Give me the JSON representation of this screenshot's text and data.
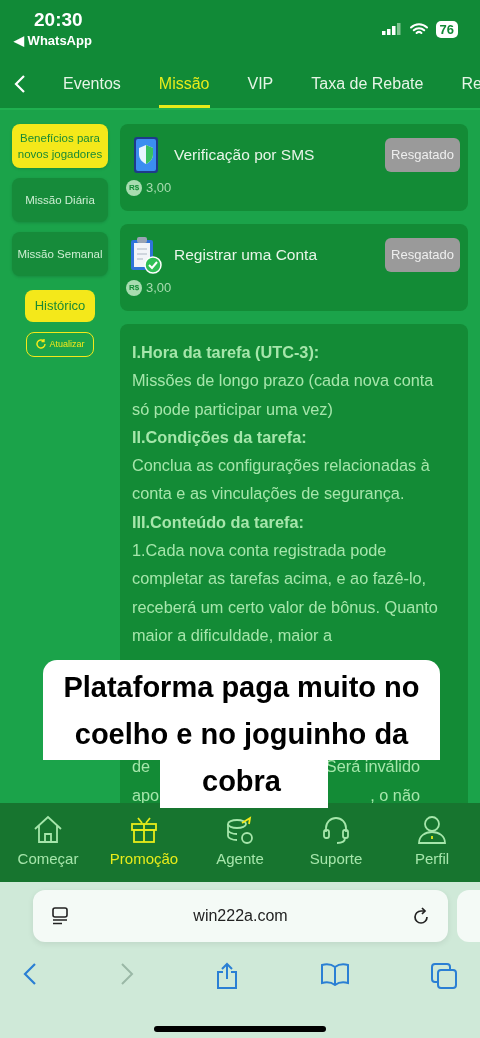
{
  "status_bar": {
    "time": "20:30",
    "back_app": "◀ WhatsApp",
    "battery": "76"
  },
  "tabs": [
    {
      "label": "Eventos",
      "selected": false
    },
    {
      "label": "Missão",
      "selected": true
    },
    {
      "label": "VIP",
      "selected": false
    },
    {
      "label": "Taxa de Rebate",
      "selected": false
    },
    {
      "label": "Re",
      "selected": false
    }
  ],
  "sidebar": {
    "items": [
      {
        "label": "Benefícios para novos jogadores",
        "selected": true
      },
      {
        "label": "Missão Diária",
        "selected": false
      },
      {
        "label": "Missão Semanal",
        "selected": false
      }
    ],
    "history_button": "Histórico",
    "refresh_button": "Atualizar"
  },
  "missions": [
    {
      "kind": "phone",
      "title": "Verificação por SMS",
      "button": "Resgatado",
      "currency": "R$",
      "reward": "3,00"
    },
    {
      "kind": "clipboard",
      "title": "Registrar uma Conta",
      "button": "Resgatado",
      "currency": "R$",
      "reward": "3,00"
    }
  ],
  "rules": {
    "lines": [
      {
        "kind": "heading",
        "text": "I.Hora da tarefa (UTC-3):"
      },
      {
        "kind": "text",
        "text": "Missões de longo prazo (cada nova conta só pode participar uma vez)"
      },
      {
        "kind": "heading",
        "text": "II.Condições da tarefa:"
      },
      {
        "kind": "text",
        "text": "Conclua as configurações relacionadas à conta e as vinculações de segurança."
      },
      {
        "kind": "heading",
        "text": "III.Conteúdo da tarefa:"
      },
      {
        "kind": "text",
        "text": "1.Cada nova conta registrada pode completar as tarefas acima, e ao fazê-lo, receberá um certo valor de bônus. Quanto maior a dificuldade, maior a"
      }
    ],
    "obscured_lines": [
      {
        "left": "de",
        "right": "Será inválido"
      },
      {
        "left": "apo",
        "right": ", o não"
      }
    ]
  },
  "caption": "Plataforma paga muito no coelho e no joguinho da cobra",
  "bottom_nav": [
    {
      "label": "Começar",
      "selected": false
    },
    {
      "label": "Promoção",
      "selected": true
    },
    {
      "label": "Agente",
      "selected": false
    },
    {
      "label": "Suporte",
      "selected": false
    },
    {
      "label": "Perfil",
      "selected": false
    }
  ],
  "browser": {
    "url": "win222a.com"
  }
}
